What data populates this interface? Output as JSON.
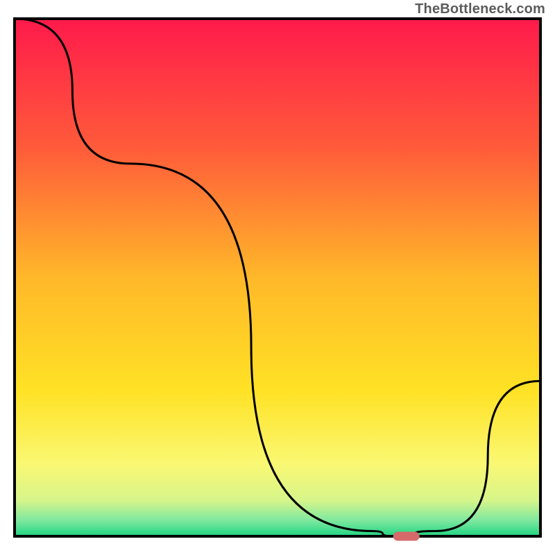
{
  "watermark": "TheBottleneck.com",
  "chart_data": {
    "type": "line",
    "title": "",
    "xlabel": "",
    "ylabel": "",
    "xlim": [
      0,
      100
    ],
    "ylim": [
      0,
      100
    ],
    "x": [
      0,
      22,
      68,
      72,
      80,
      100
    ],
    "values": [
      100,
      72,
      1,
      0,
      1,
      30
    ],
    "marker": {
      "x_center": 74,
      "x_min": 72,
      "x_max": 77,
      "y": 0
    },
    "background_gradient": [
      {
        "pos": 0.0,
        "color": "#ff1a4b"
      },
      {
        "pos": 0.25,
        "color": "#ff5b3a"
      },
      {
        "pos": 0.5,
        "color": "#ffb829"
      },
      {
        "pos": 0.72,
        "color": "#ffe225"
      },
      {
        "pos": 0.86,
        "color": "#faf873"
      },
      {
        "pos": 0.93,
        "color": "#d7f58a"
      },
      {
        "pos": 0.97,
        "color": "#7de89f"
      },
      {
        "pos": 1.0,
        "color": "#1fd482"
      }
    ],
    "frame_color": "#000000",
    "curve_color": "#000000",
    "marker_color": "#d66a6a"
  }
}
